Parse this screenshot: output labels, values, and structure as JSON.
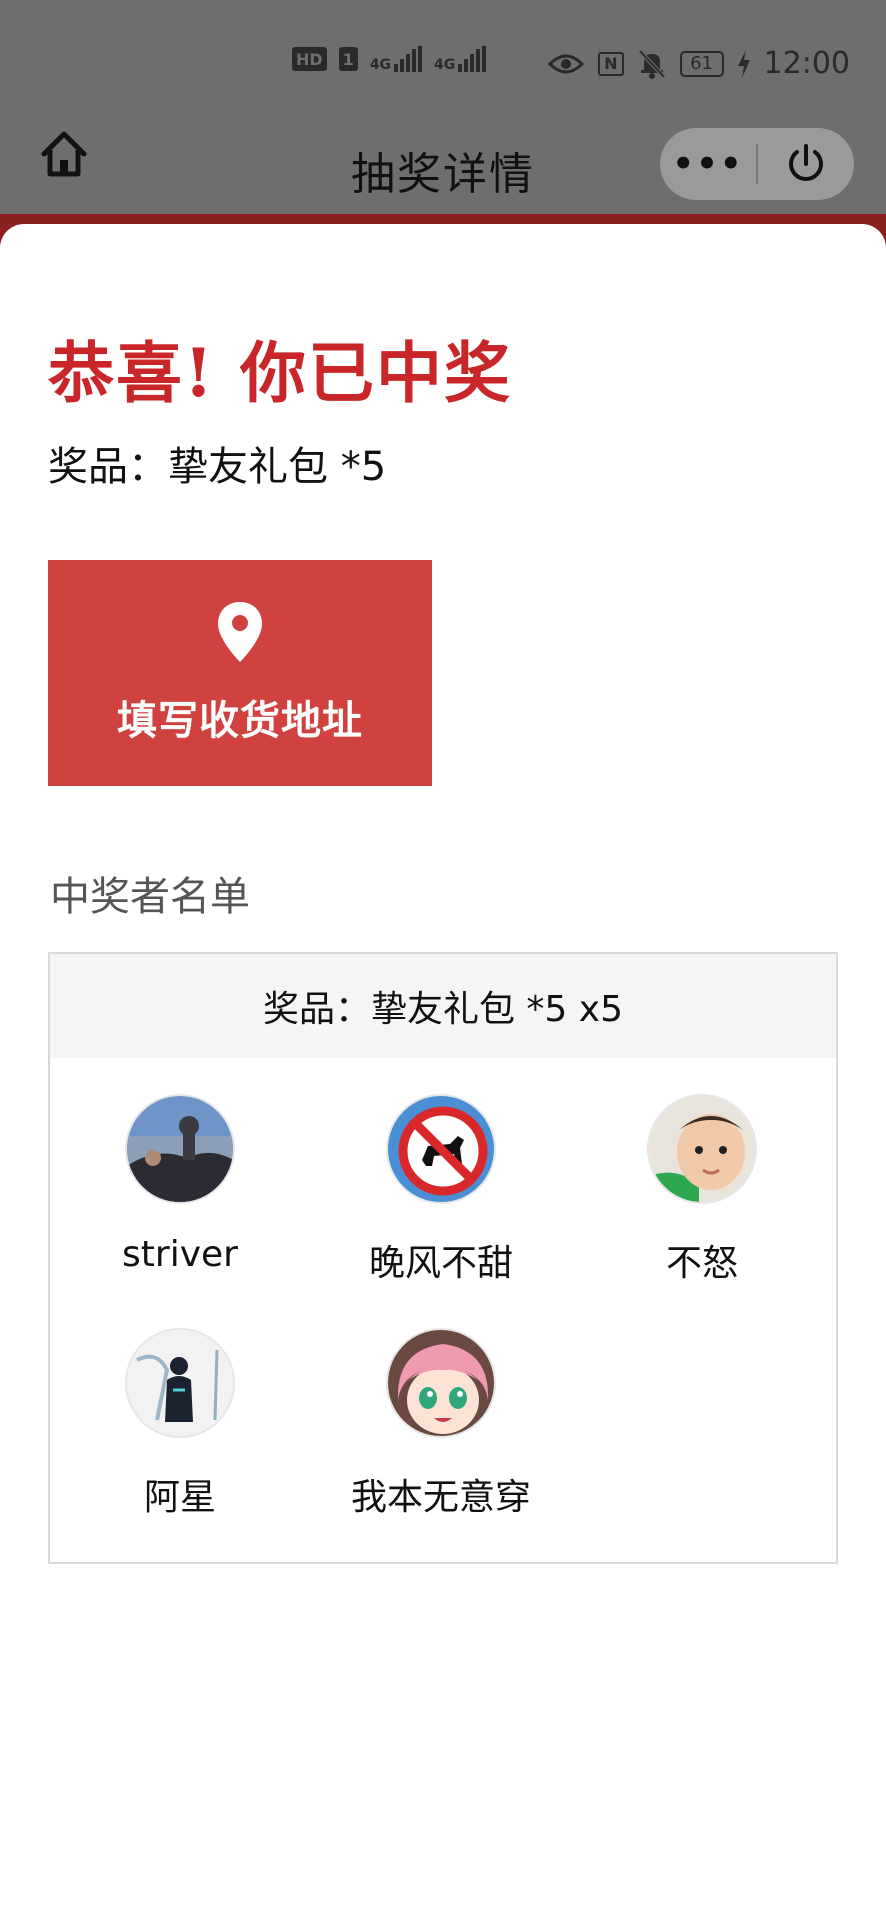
{
  "status_bar": {
    "hd": "HD",
    "sim1": "1",
    "net1": "4G",
    "net2": "4G",
    "nfc": "N",
    "battery": "61",
    "time": "12:00"
  },
  "nav": {
    "title": "抽奖详情",
    "more_label": "•••"
  },
  "result": {
    "congrats": "恭喜! 你已中奖",
    "prize_line": "奖品：挚友礼包 *5"
  },
  "address_button": {
    "label": "填写收货地址",
    "icon": "location-pin-icon"
  },
  "winners": {
    "heading": "中奖者名单",
    "box_header": "奖品：挚友礼包 *5 x5",
    "list": [
      {
        "name": "striver",
        "avatar": "photo-avatar"
      },
      {
        "name": "晚风不甜",
        "avatar": "no-dogs-sign-avatar"
      },
      {
        "name": "不怒",
        "avatar": "baby-photo-avatar"
      },
      {
        "name": "阿星",
        "avatar": "dark-figure-avatar"
      },
      {
        "name": "我本无意穿",
        "avatar": "anime-girl-avatar"
      }
    ]
  },
  "colors": {
    "accent_red": "#c9262a",
    "button_red": "#cf4240",
    "backdrop": "#6e6e6e"
  }
}
